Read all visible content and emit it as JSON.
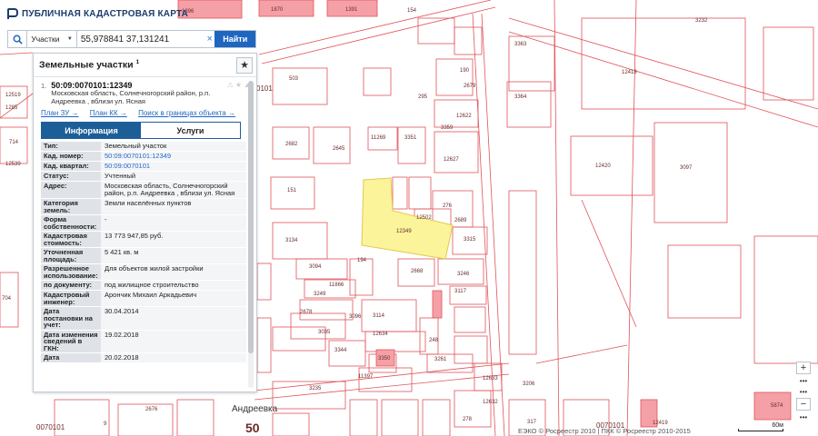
{
  "app": {
    "title": "ПУБЛИЧНАЯ КАДАСТРОВАЯ КАРТА",
    "logo_icon": "cadastre-logo-icon"
  },
  "search": {
    "type_selected": "Участки",
    "value": "55,978841 37,131241",
    "clear_symbol": "×",
    "button_label": "Найти",
    "icon": "search-icon"
  },
  "panel": {
    "title": "Земельные участки",
    "title_count": "1",
    "favorite_icon": "star-icon",
    "item": {
      "index": "1.",
      "cadastral_number": "50:09:0070101:12349",
      "address": "Московская область, Солнечногорский район, р.п. Андреевка , вблизи ул. Ясная",
      "links": [
        "План ЗУ →",
        "План КК →",
        "Поиск в границах объекта →"
      ]
    },
    "tabs": [
      "Информация",
      "Услуги"
    ],
    "rows": [
      {
        "key": "Тип:",
        "value": "Земельный участок"
      },
      {
        "key": "Кад. номер:",
        "value": "50:09:0070101:12349",
        "link": true
      },
      {
        "key": "Кад. квартал:",
        "value": "50:09:0070101",
        "link": true
      },
      {
        "key": "Статус:",
        "value": "Учтенный"
      },
      {
        "key": "Адрес:",
        "value": "Московская область, Солнечногорский район, р.п. Андреевка , вблизи ул. Ясная"
      },
      {
        "key": "Категория земель:",
        "value": "Земли населённых пунктов"
      },
      {
        "key": "Форма собственности:",
        "value": "-"
      },
      {
        "key": "Кадастровая стоимость:",
        "value": "13 773 947,85 руб."
      },
      {
        "key": "Уточненная площадь:",
        "value": "5 421 кв. м"
      },
      {
        "key": "Разрешенное использование:",
        "value": "Для объектов жилой застройки"
      },
      {
        "key": "по документу:",
        "value": "под жилищное строительство"
      },
      {
        "key": "Кадастровый инженер:",
        "value": "Арончик Михаил Аркадьевич"
      },
      {
        "key": "Дата постановки на учет:",
        "value": "30.04.2014"
      },
      {
        "key": "Дата изменения сведений в ГКН:",
        "value": "19.02.2018"
      },
      {
        "key": "Дата",
        "value": "20.02.2018"
      }
    ]
  },
  "map": {
    "parcel_labels": [
      "1396",
      "1870",
      "1391",
      "154",
      "3232",
      "3363",
      "3364",
      "12418",
      "12420",
      "3097",
      "503",
      "12519",
      "1285",
      "714",
      "2682",
      "2645",
      "11269",
      "3351",
      "3359",
      "12627",
      "151",
      "3134",
      "12349",
      "276",
      "3315",
      "2689",
      "12502",
      "194",
      "3094",
      "3096",
      "3249",
      "2668",
      "3246",
      "3117",
      "12634",
      "3114",
      "3035",
      "2678",
      "3344",
      "3350",
      "248",
      "3261",
      "11397",
      "3235",
      "12632",
      "278",
      "12633",
      "2676",
      "317",
      "3206",
      "9",
      "50",
      "0070101",
      "12419",
      "5874",
      "11866",
      "12622",
      "190",
      "2679",
      "295",
      "12539",
      "704"
    ],
    "selected_parcel": "12349",
    "place_label": "Андреевка",
    "highlight_color": "#fbf49a",
    "parcel_line_color": "#e0545a"
  },
  "controls": {
    "zoom_in": "+",
    "zoom_out": "−",
    "more": "•••",
    "scale_label": "60м",
    "copyright": "ЕЭКО © Росреестр 2010 | ПКК © Росреестр 2010-2015"
  }
}
